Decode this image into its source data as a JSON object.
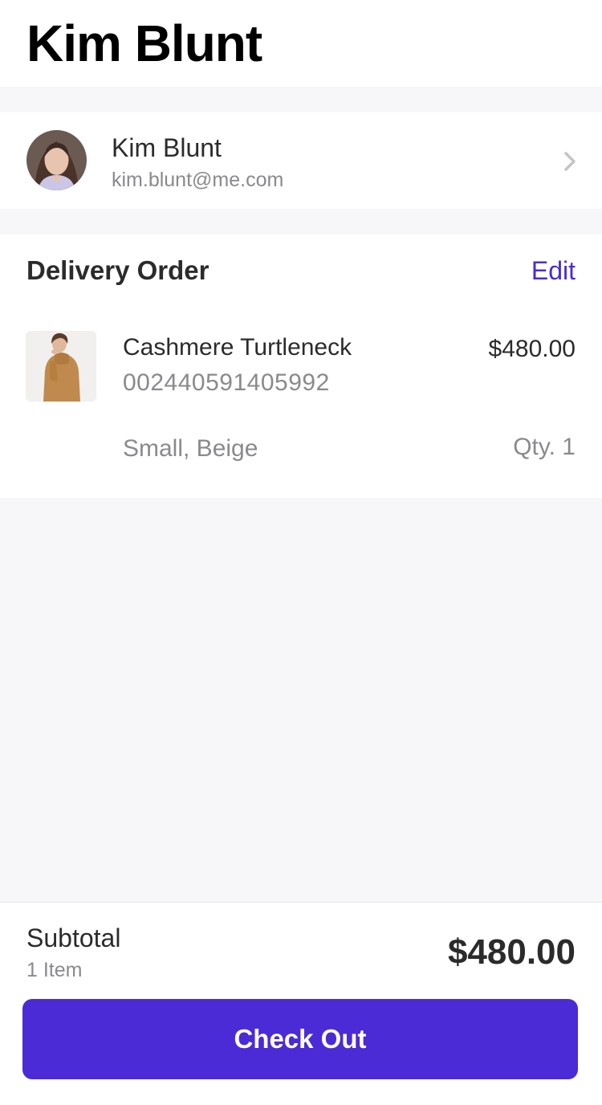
{
  "header": {
    "title": "Kim Blunt"
  },
  "profile": {
    "name": "Kim Blunt",
    "email": "kim.blunt@me.com",
    "avatar_icon": "user-avatar",
    "chevron_icon": "chevron-right-icon"
  },
  "order": {
    "section_title": "Delivery Order",
    "edit_label": "Edit",
    "items": [
      {
        "name": "Cashmere Turtleneck",
        "sku": "002440591405992",
        "price": "$480.00",
        "variant": "Small, Beige",
        "quantity": "Qty. 1",
        "thumbnail_icon": "product-thumbnail"
      }
    ]
  },
  "summary": {
    "subtotal_label": "Subtotal",
    "item_count": "1 Item",
    "subtotal_amount": "$480.00"
  },
  "checkout": {
    "button_label": "Check Out"
  },
  "colors": {
    "accent": "#4a2bd6",
    "background": "#f7f7f9",
    "card": "#ffffff",
    "primary_text": "#2b2b2b",
    "secondary_text": "#8a8a8e"
  }
}
